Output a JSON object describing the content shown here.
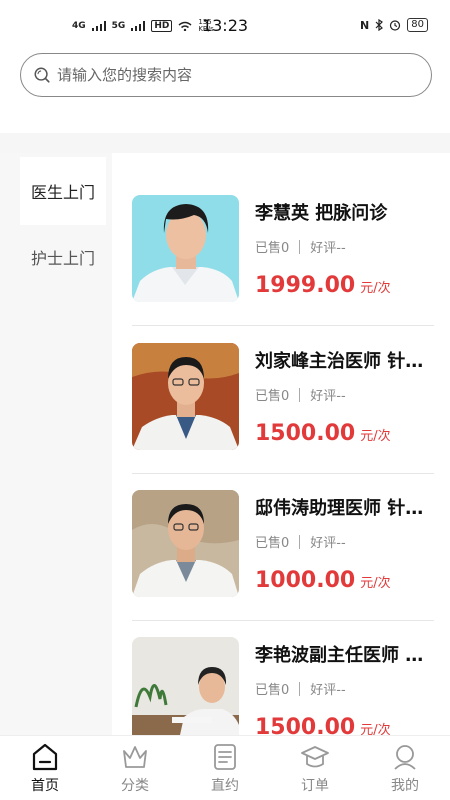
{
  "status_bar": {
    "network_left": "4G",
    "network_right": "5G",
    "hd": "HD",
    "speed": "135\nKB/s",
    "time": "13:23",
    "battery": "80"
  },
  "search": {
    "placeholder": "请输入您的搜索内容",
    "value": ""
  },
  "sidebar": {
    "items": [
      {
        "label": "医生上门",
        "active": true
      },
      {
        "label": "护士上门",
        "active": false
      }
    ]
  },
  "doctors": [
    {
      "name": "李慧英 把脉问诊",
      "sold": "已售0",
      "rating": "好评--",
      "price": "1999.00",
      "unit": "元/次",
      "photo_bg": "#8fdde8"
    },
    {
      "name": "刘家峰主治医师 针灸推拿",
      "sold": "已售0",
      "rating": "好评--",
      "price": "1500.00",
      "unit": "元/次",
      "photo_bg": "#b5532a"
    },
    {
      "name": "邸伟涛助理医师 针灸推拿",
      "sold": "已售0",
      "rating": "好评--",
      "price": "1000.00",
      "unit": "元/次",
      "photo_bg": "#c9b8a0"
    },
    {
      "name": "李艳波副主任医师 把脉问诊",
      "sold": "已售0",
      "rating": "好评--",
      "price": "1500.00",
      "unit": "元/次",
      "photo_bg": "#e9e7e2"
    }
  ],
  "tabbar": {
    "items": [
      {
        "label": "首页",
        "icon": "home-icon",
        "active": true
      },
      {
        "label": "分类",
        "icon": "crown-icon",
        "active": false
      },
      {
        "label": "直约",
        "icon": "book-icon",
        "active": false
      },
      {
        "label": "订单",
        "icon": "graduation-cap-icon",
        "active": false
      },
      {
        "label": "我的",
        "icon": "profile-icon",
        "active": false
      }
    ]
  },
  "colors": {
    "price": "#e23a3a",
    "accent": "#111111"
  }
}
